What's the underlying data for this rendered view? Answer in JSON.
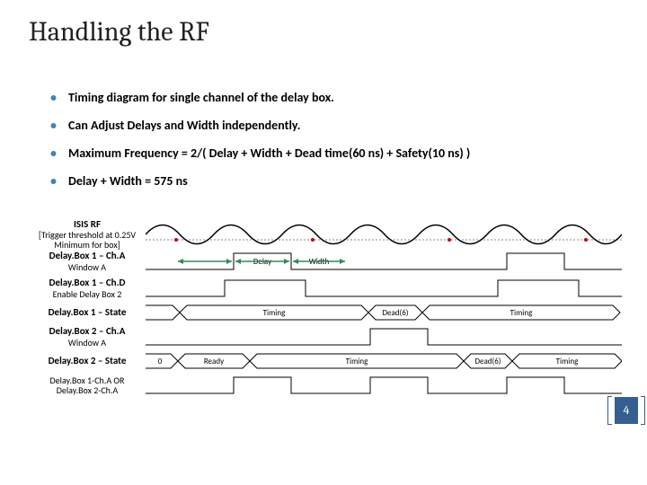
{
  "title": "Handling the RF",
  "bullets": [
    "Timing diagram for single channel of the delay box.",
    "Can Adjust Delays and Width independently.",
    "Maximum Frequency = 2/( Delay + Width + Dead time(60 ns) + Safety(10 ns) )",
    "Delay + Width = 575 ns"
  ],
  "page_number": "4",
  "signals": {
    "isis_rf": {
      "name": "ISIS RF",
      "sub": "[Trigger threshold at 0.25V Minimum for box]"
    },
    "db1_cha": {
      "name": "Delay.Box 1 – Ch.A",
      "sub": "Window A"
    },
    "db1_chd": {
      "name": "Delay.Box 1 – Ch.D",
      "sub": "Enable Delay Box 2"
    },
    "db1_state": {
      "name": "Delay.Box 1 – State",
      "sub": ""
    },
    "db2_cha": {
      "name": "Delay.Box 2 – Ch.A",
      "sub": "Window A"
    },
    "db2_state": {
      "name": "Delay.Box 2 – State",
      "sub": ""
    },
    "or": {
      "name": "Delay.Box 1-Ch.A OR",
      "sub": "Delay.Box 2-Ch.A"
    }
  },
  "timing_labels": {
    "delay": "Delay",
    "width": "Width",
    "timing": "Timing",
    "ready": "Ready",
    "dead": "Dead(6)"
  },
  "chart_data": {
    "type": "timing-diagram",
    "cycles_shown": 3,
    "trigger_level_volts": 0.25,
    "annotations": {
      "dead_time_ns": 60,
      "safety_ns": 10,
      "delay_plus_width_ns": 575
    },
    "tracks": [
      {
        "id": "isis_rf",
        "kind": "sine",
        "periods": 3.5
      },
      {
        "id": "db1_cha",
        "kind": "pulse",
        "active_cycles": [
          0,
          2
        ],
        "span_label_delay": "Delay",
        "span_label_width": "Width"
      },
      {
        "id": "db1_chd",
        "kind": "pulse",
        "active_cycles": [
          0,
          2
        ],
        "wider_than_cha": true
      },
      {
        "id": "db1_state",
        "kind": "bus",
        "states_per_cycle": [
          "Timing",
          "Dead(6)"
        ],
        "initial": "Ready"
      },
      {
        "id": "db2_cha",
        "kind": "pulse",
        "active_cycles": [
          1
        ]
      },
      {
        "id": "db2_state",
        "kind": "bus",
        "states": [
          "0",
          "Ready",
          "Timing",
          "Dead(6)",
          "Timing"
        ]
      },
      {
        "id": "or",
        "kind": "pulse",
        "active_cycles": [
          0,
          1,
          2
        ]
      }
    ]
  }
}
